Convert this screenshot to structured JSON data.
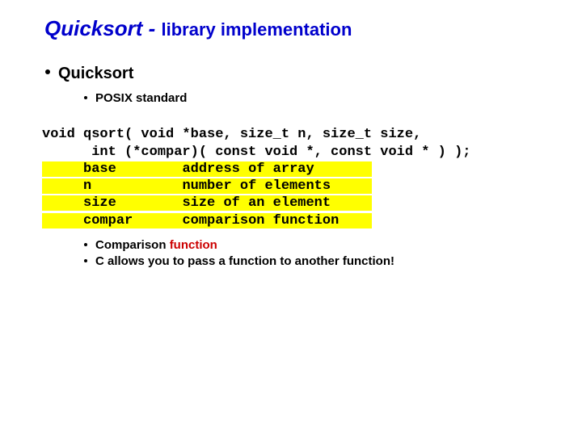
{
  "title_left": "Quicksort - ",
  "title_right": "library implementation",
  "bullet_quicksort": "Quicksort",
  "sub_posix": "POSIX standard",
  "code": {
    "l1": "void qsort( void *base, size_t n, size_t size,",
    "l2": "      int (*compar)( const void *, const void * ) );",
    "arg1_name": "base",
    "arg1_desc": "address of array",
    "arg2_name": "n",
    "arg2_desc": "number of elements",
    "arg3_name": "size",
    "arg3_desc": "size of an element",
    "arg4_name": "compar",
    "arg4_desc": "comparison function"
  },
  "sub_comp_a": "Comparison ",
  "sub_comp_b": "function",
  "sub_pass": "C allows you to pass a function to another function!"
}
